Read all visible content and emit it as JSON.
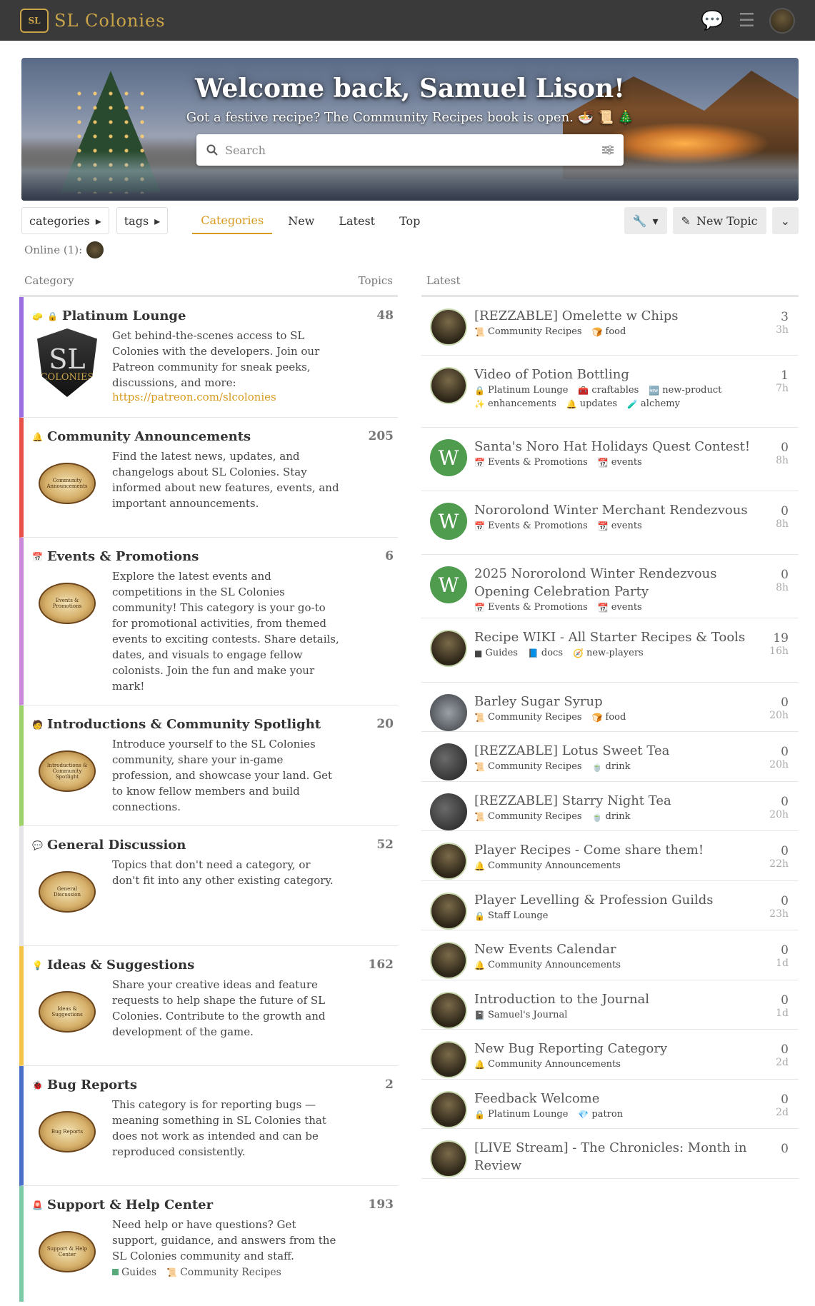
{
  "header": {
    "brand": "SL Colonies",
    "logo_text": "SL"
  },
  "banner": {
    "welcome": "Welcome back, Samuel Lison!",
    "subline": "Got a festive recipe? The Community Recipes book is open. 🍜 📜 🎄",
    "search_placeholder": "Search"
  },
  "nav": {
    "categories_dd": "categories",
    "tags_dd": "tags",
    "tabs": [
      "Categories",
      "New",
      "Latest",
      "Top"
    ],
    "new_topic": "New Topic"
  },
  "online": "Online (1):",
  "left": {
    "col_category": "Category",
    "col_topics": "Topics",
    "cats": [
      {
        "name": "Platinum Lounge",
        "count": "48",
        "desc": "Get behind-the-scenes access to SL Colonies with the developers. Join our Patreon community for sneak peeks, discussions, and more:",
        "link": "https://patreon.com/slcolonies",
        "color": "#9b6fe0"
      },
      {
        "name": "Community Announcements",
        "count": "205",
        "desc": "Find the latest news, updates, and changelogs about SL Colonies. Stay informed about new features, events, and important announcements.",
        "badge": "Community Announcements",
        "color": "#e8504a"
      },
      {
        "name": "Events & Promotions",
        "count": "6",
        "desc": "Explore the latest events and competitions in the SL Colonies community! This category is your go-to for promotional activities, from themed events to exciting contests. Share details, dates, and visuals to engage fellow colonists. Join the fun and make your mark!",
        "badge": "Events & Promotions",
        "color": "#c88ad8"
      },
      {
        "name": "Introductions & Community Spotlight",
        "count": "20",
        "desc": "Introduce yourself to the SL Colonies community, share your in-game profession, and showcase your land. Get to know fellow members and build connections.",
        "badge": "Introductions & Community Spotlight",
        "color": "#9dd26a"
      },
      {
        "name": "General Discussion",
        "count": "52",
        "desc": "Topics that don't need a category, or don't fit into any other existing category.",
        "badge": "General Discussion",
        "color": "#e6e6ea"
      },
      {
        "name": "Ideas & Suggestions",
        "count": "162",
        "desc": "Share your creative ideas and feature requests to help shape the future of SL Colonies. Contribute to the growth and development of the game.",
        "badge": "Ideas & Suggestions",
        "color": "#f3c44a"
      },
      {
        "name": "Bug Reports",
        "count": "2",
        "desc": "This category is for reporting bugs — meaning something in SL Colonies that does not work as intended and can be reproduced consistently.",
        "badge": "Bug Reports",
        "color": "#4b6fc8"
      },
      {
        "name": "Support & Help Center",
        "count": "193",
        "desc": "Need help or have questions? Get support, guidance, and answers from the SL Colonies community and staff.",
        "badge": "Support & Help Center",
        "color": "#7dcaa8",
        "sub": [
          "Guides",
          "Community Recipes"
        ]
      }
    ]
  },
  "right": {
    "col_latest": "Latest",
    "topics": [
      {
        "title": "[REZZABLE] Omelette w Chips",
        "tags": [
          "Community Recipes",
          "food"
        ],
        "n": "3",
        "t": "3h",
        "av": "a"
      },
      {
        "title": "Video of Potion Bottling",
        "tags": [
          "Platinum Lounge",
          "craftables",
          "new-product",
          "enhancements",
          "updates",
          "alchemy"
        ],
        "n": "1",
        "t": "7h",
        "av": "a"
      },
      {
        "title": "Santa's Noro Hat Holidays Quest Contest!",
        "tags": [
          "Events & Promotions",
          "events"
        ],
        "n": "0",
        "t": "8h",
        "av": "w"
      },
      {
        "title": "Nororolond Winter Merchant Rendezvous",
        "tags": [
          "Events & Promotions",
          "events"
        ],
        "n": "0",
        "t": "8h",
        "av": "w"
      },
      {
        "title": "2025 Nororolond Winter Rendezvous Opening Celebration Party",
        "tags": [
          "Events & Promotions",
          "events"
        ],
        "n": "0",
        "t": "8h",
        "av": "w"
      },
      {
        "title": "Recipe WIKI - All Starter Recipes & Tools",
        "tags": [
          "Guides",
          "docs",
          "new-players"
        ],
        "n": "19",
        "t": "16h",
        "av": "a"
      },
      {
        "title": "Barley Sugar Syrup",
        "tags": [
          "Community Recipes",
          "food"
        ],
        "n": "0",
        "t": "20h",
        "av": "g"
      },
      {
        "title": "[REZZABLE] Lotus Sweet Tea",
        "tags": [
          "Community Recipes",
          "drink"
        ],
        "n": "0",
        "t": "20h",
        "av": "d"
      },
      {
        "title": "[REZZABLE] Starry Night Tea",
        "tags": [
          "Community Recipes",
          "drink"
        ],
        "n": "0",
        "t": "20h",
        "av": "d"
      },
      {
        "title": "Player Recipes - Come share them!",
        "tags": [
          "Community Announcements"
        ],
        "n": "0",
        "t": "22h",
        "av": "a"
      },
      {
        "title": "Player Levelling & Profession Guilds",
        "tags": [
          "Staff Lounge"
        ],
        "n": "0",
        "t": "23h",
        "av": "a"
      },
      {
        "title": "New Events Calendar",
        "tags": [
          "Community Announcements"
        ],
        "n": "0",
        "t": "1d",
        "av": "a"
      },
      {
        "title": "Introduction to the Journal",
        "tags": [
          "Samuel's Journal"
        ],
        "n": "0",
        "t": "1d",
        "av": "a"
      },
      {
        "title": "New Bug Reporting Category",
        "tags": [
          "Community Announcements"
        ],
        "n": "0",
        "t": "2d",
        "av": "a"
      },
      {
        "title": "Feedback Welcome",
        "tags": [
          "Platinum Lounge",
          "patron"
        ],
        "n": "0",
        "t": "2d",
        "av": "a"
      },
      {
        "title": "[LIVE Stream] - The Chronicles: Month in Review",
        "tags": [],
        "n": "0",
        "t": "",
        "av": "a"
      }
    ]
  }
}
